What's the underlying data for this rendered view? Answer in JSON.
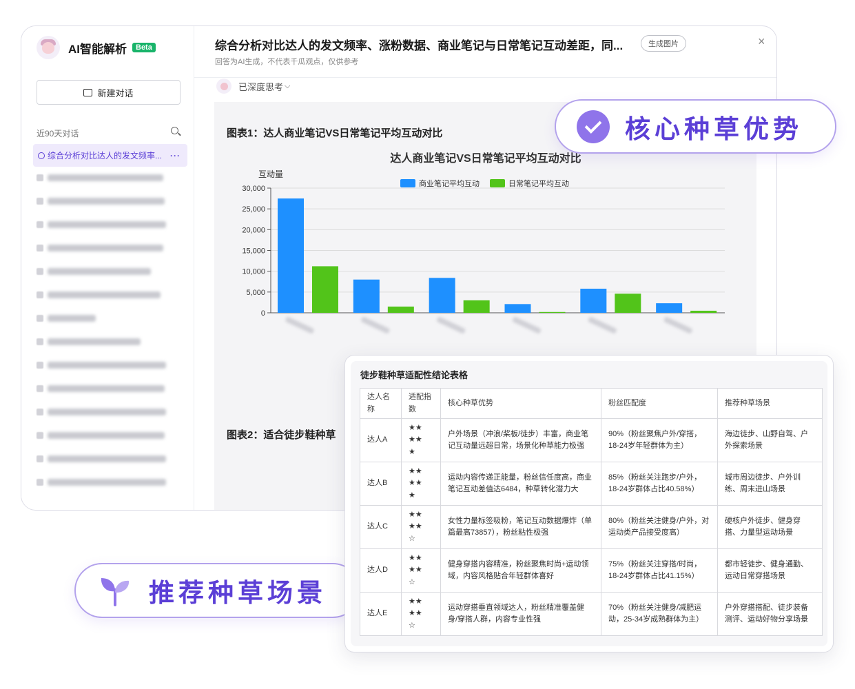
{
  "sidebar": {
    "brand_title": "AI智能解析",
    "beta": "Beta",
    "new_chat": "新建对话",
    "recent_label": "近90天对话",
    "active_item": "综合分析对比达人的发文频率...",
    "more": "···"
  },
  "header": {
    "title": "综合分析对比达人的发文频率、涨粉数据、商业笔记与日常笔记互动差距，同...",
    "gen_image": "生成图片",
    "close": "×",
    "subtitle": "回答为AI生成，不代表千瓜观点，仅供参考",
    "thinking": "已深度思考"
  },
  "content": {
    "chart1_heading": "图表1：达人商业笔记VS日常笔记平均互动对比",
    "chart2_heading": "图表2：适合徒步鞋种草"
  },
  "chart_data": {
    "type": "bar",
    "title": "达人商业笔记VS日常笔记平均互动对比",
    "ylabel": "互动量",
    "ylim": [
      0,
      30000
    ],
    "yticks": [
      "30,000",
      "25,000",
      "20,000",
      "15,000",
      "10,000",
      "5,000",
      "0"
    ],
    "categories": [
      "",
      "",
      "",
      "",
      "",
      ""
    ],
    "legend_position": "top",
    "series": [
      {
        "name": "商业笔记平均互动",
        "color": "#1e90ff",
        "values": [
          27500,
          8000,
          8400,
          2100,
          5800,
          2300
        ]
      },
      {
        "name": "日常笔记平均互动",
        "color": "#52c41a",
        "values": [
          11200,
          1500,
          3000,
          200,
          4600,
          500
        ]
      }
    ]
  },
  "badges": {
    "core": "核心种草优势",
    "scene": "推荐种草场景"
  },
  "table": {
    "title": "徒步鞋种草适配性结论表格",
    "headers": [
      "达人名称",
      "适配指数",
      "核心种草优势",
      "粉丝匹配度",
      "推荐种草场景"
    ],
    "rows": [
      {
        "name": "达人A",
        "stars": "★★\n★★\n★",
        "advantage": "户外场景（冲浪/桨板/徒步）丰富，商业笔记互动量远超日常，场景化种草能力极强",
        "match": "90%（粉丝聚焦户外/穿搭，18-24岁年轻群体为主）",
        "scene": "海边徒步、山野自驾、户外探索场景"
      },
      {
        "name": "达人B",
        "stars": "★★\n★★\n★",
        "advantage": "运动内容传递正能量，粉丝信任度高，商业笔记互动差值达6484，种草转化潜力大",
        "match": "85%（粉丝关注跑步/户外，18-24岁群体占比40.58%）",
        "scene": "城市周边徒步、户外训练、周末进山场景"
      },
      {
        "name": "达人C",
        "stars": "★★\n★★\n☆",
        "advantage": "女性力量标签吸粉，笔记互动数据爆炸（单篇最高73857），粉丝粘性极强",
        "match": "80%（粉丝关注健身/户外，对运动类产品接受度高）",
        "scene": "硬核户外徒步、健身穿搭、力量型运动场景"
      },
      {
        "name": "达人D",
        "stars": "★★\n★★\n☆",
        "advantage": "健身穿搭内容精准，粉丝聚焦时尚+运动领域，内容风格贴合年轻群体喜好",
        "match": "75%（粉丝关注穿搭/时尚，18-24岁群体占比41.15%）",
        "scene": "都市轻徒步、健身通勤、运动日常穿搭场景"
      },
      {
        "name": "达人E",
        "stars": "★★\n★★\n☆",
        "advantage": "运动穿搭垂直领域达人，粉丝精准覆盖健身/穿搭人群，内容专业性强",
        "match": "70%（粉丝关注健身/减肥运动，25-34岁成熟群体为主）",
        "scene": "户外穿搭搭配、徒步装备测评、运动好物分享场景"
      }
    ]
  }
}
